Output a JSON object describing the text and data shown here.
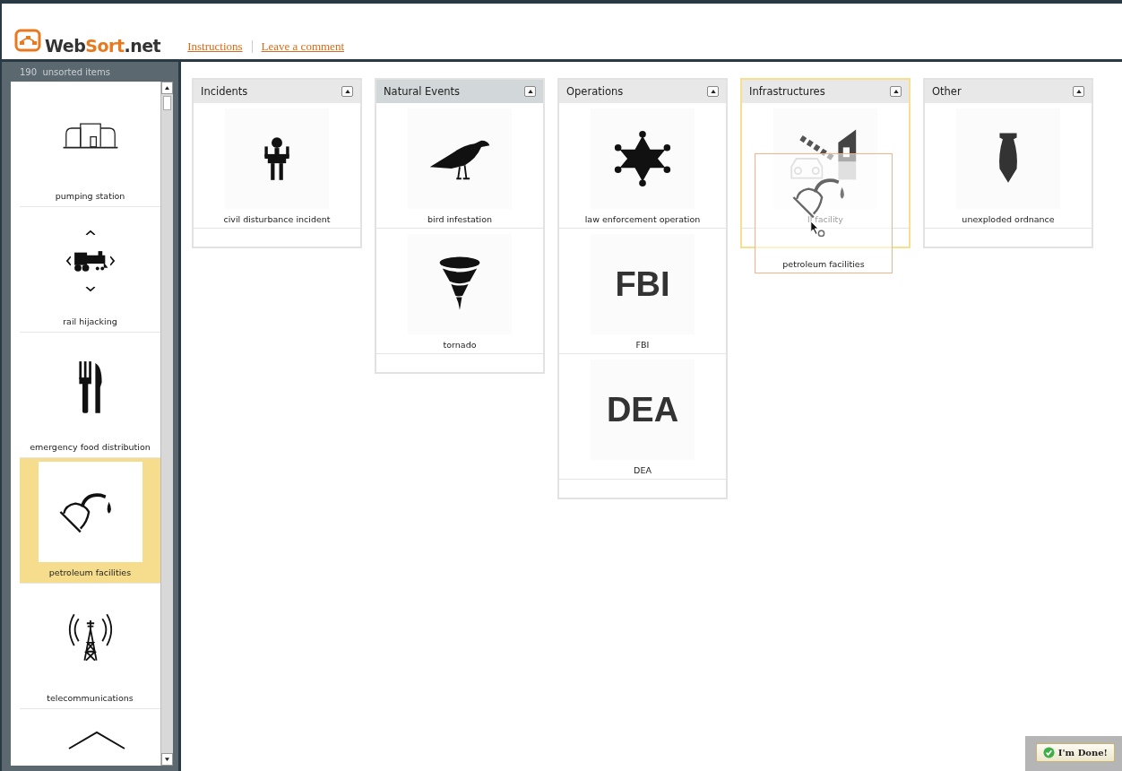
{
  "header": {
    "logo": {
      "first": "Web",
      "second": "Sort",
      "suffix": ".net"
    },
    "links": [
      "Instructions",
      "Leave a comment"
    ]
  },
  "sidebar": {
    "count": "190",
    "count_label": "unsorted items",
    "items": [
      {
        "label": "pumping station",
        "kind": "building",
        "selected": false
      },
      {
        "label": "rail hijacking",
        "kind": "train",
        "selected": false
      },
      {
        "label": "emergency food distribution",
        "kind": "cutlery",
        "selected": false
      },
      {
        "label": "petroleum facilities",
        "kind": "pump",
        "selected": true
      },
      {
        "label": "telecommunications",
        "kind": "tower",
        "selected": false
      },
      {
        "kind": "roof",
        "selected": false
      }
    ]
  },
  "categories": [
    {
      "title": "Incidents",
      "drop_target": false,
      "items": [
        {
          "label": "civil disturbance incident",
          "kind": "figure"
        }
      ]
    },
    {
      "title": "Natural Events",
      "drop_target": false,
      "items": [
        {
          "label": "bird infestation",
          "kind": "bird"
        },
        {
          "label": "tornado",
          "kind": "tornado"
        }
      ]
    },
    {
      "title": "Operations",
      "drop_target": false,
      "items": [
        {
          "label": "law enforcement operation",
          "kind": "star"
        },
        {
          "label": "FBI",
          "kind": "logo",
          "logo_text": "FBI"
        },
        {
          "label": "DEA",
          "kind": "logo",
          "logo_text": "DEA"
        }
      ]
    },
    {
      "title": "Infrastructures",
      "drop_target": true,
      "items": [
        {
          "label": "ll facility",
          "kind": "tollgate"
        }
      ]
    },
    {
      "title": "Other",
      "drop_target": false,
      "items": [
        {
          "label": "unexploded ordnance",
          "kind": "bomb"
        }
      ]
    }
  ],
  "dragged_item": {
    "label": "petroleum facilities",
    "kind": "pump"
  },
  "done_button": "I'm Done!"
}
